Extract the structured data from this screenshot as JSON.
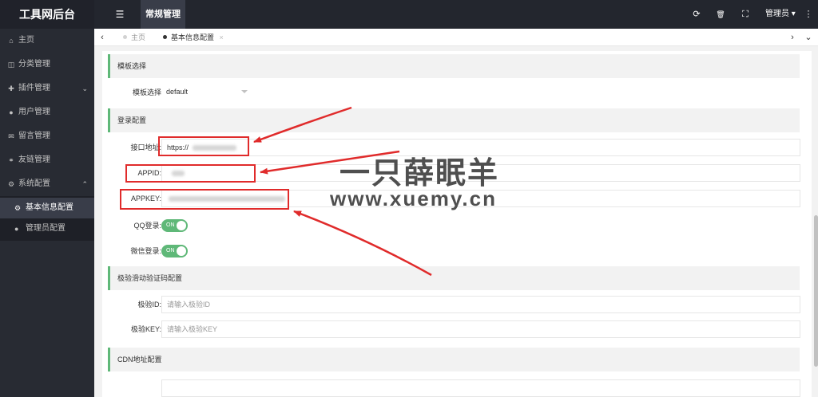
{
  "app": {
    "title": "工具网后台"
  },
  "topbar": {
    "menu_icon": "☰",
    "nav_label": "常规管理",
    "refresh_icon": "⟳",
    "delete_icon": "🗑",
    "fullscreen_icon": "⛶",
    "admin_label": "管理员 ▾",
    "more_icon": "⋮"
  },
  "sidebar": {
    "items": [
      {
        "label": "主页",
        "icon": "⌂"
      },
      {
        "label": "分类管理",
        "icon": "◫"
      },
      {
        "label": "插件管理",
        "icon": "✚",
        "chevron": "⌄"
      },
      {
        "label": "用户管理",
        "icon": "●"
      },
      {
        "label": "留言管理",
        "icon": "✉"
      },
      {
        "label": "友链管理",
        "icon": "⚭"
      },
      {
        "label": "系统配置",
        "icon": "⚙",
        "chevron": "⌃"
      }
    ],
    "sub_items": [
      {
        "label": "基本信息配置",
        "icon": "⚙"
      },
      {
        "label": "管理员配置",
        "icon": "●"
      }
    ]
  },
  "tabs": {
    "prev_icon": "‹",
    "next_icon": "›",
    "dropdown_icon": "⌄",
    "items": [
      {
        "label": "主页"
      },
      {
        "label": "基本信息配置",
        "close": "×"
      }
    ]
  },
  "form": {
    "sections": {
      "template": "模板选择",
      "login": "登录配置",
      "geetest": "极验滑动验证码配置",
      "cdn": "CDN地址配置"
    },
    "template_label": "模板选择",
    "template_value": "default",
    "api_label": "接口地址:",
    "api_value": "https://",
    "appid_label": "APPID:",
    "appkey_label": "APPKEY:",
    "qq_label": "QQ登录:",
    "qq_toggle": "ON",
    "wechat_label": "微信登录:",
    "wechat_toggle": "ON",
    "geetest_id_label": "极验ID:",
    "geetest_id_placeholder": "请输入极验ID",
    "geetest_key_label": "极验KEY:",
    "geetest_key_placeholder": "请输入极验KEY"
  },
  "watermark": {
    "title": "一只薛眠羊",
    "url": "www.xuemy.cn"
  },
  "colors": {
    "sidebar_bg": "#282b33",
    "accent_green": "#5fb878",
    "annotation_red": "#e02b2b"
  }
}
